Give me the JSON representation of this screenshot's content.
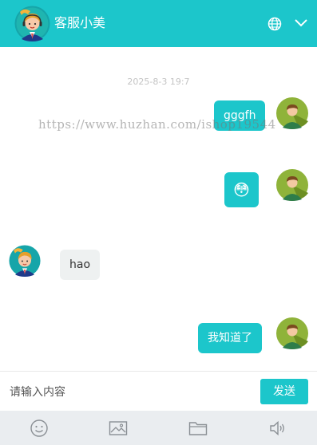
{
  "header": {
    "title": "客服小美",
    "icons": [
      "agent-avatar",
      "globe-icon",
      "chevron-down-icon"
    ]
  },
  "chat": {
    "timestamp": "2025-8-3 19:7",
    "watermark": "https://www.huzhan.com/ishop19544",
    "messages": [
      {
        "from": "user",
        "text": "gggfh"
      },
      {
        "from": "user",
        "emoji": "😳"
      },
      {
        "from": "agent",
        "text": "hao"
      },
      {
        "from": "user",
        "text": "我知道了"
      }
    ]
  },
  "input": {
    "placeholder": "请输入内容",
    "value": "",
    "send_label": "发送"
  },
  "toolbar": {
    "icons": [
      "emoji-icon",
      "image-icon",
      "folder-icon",
      "speaker-icon"
    ]
  },
  "colors": {
    "accent": "#1cc6cb",
    "toolbar_bg": "#eaedf0",
    "incoming_bubble": "#eef1f1"
  }
}
